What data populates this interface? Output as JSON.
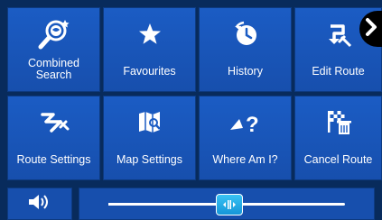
{
  "menu": {
    "tiles": [
      {
        "label": "Combined\nSearch",
        "icon": "combined-search-icon"
      },
      {
        "label": "Favourites",
        "icon": "star-icon"
      },
      {
        "label": "History",
        "icon": "history-icon"
      },
      {
        "label": "Edit Route",
        "icon": "edit-route-icon"
      },
      {
        "label": "Route Settings",
        "icon": "route-settings-icon"
      },
      {
        "label": "Map Settings",
        "icon": "map-settings-icon"
      },
      {
        "label": "Where Am I?",
        "icon": "where-am-i-icon"
      },
      {
        "label": "Cancel Route",
        "icon": "cancel-route-icon"
      }
    ]
  },
  "navigation": {
    "next_page_icon": "chevron-right-icon"
  },
  "volume": {
    "icon": "speaker-icon",
    "level_fraction": 0.51
  },
  "colors": {
    "tile": "#1b5cc4",
    "background": "#082b5c",
    "thumb": "#2bb0ea"
  }
}
